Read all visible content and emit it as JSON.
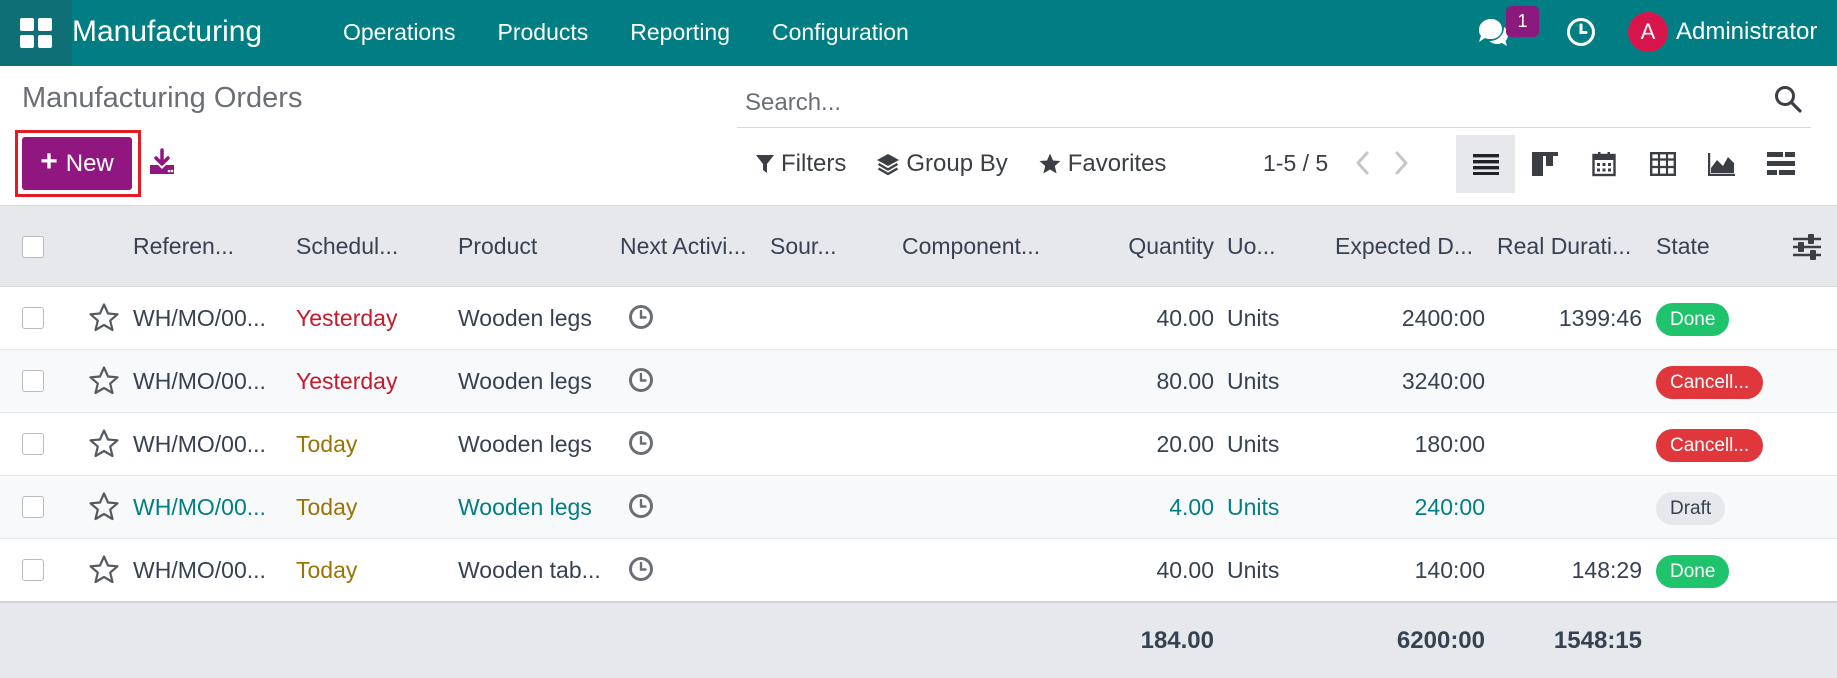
{
  "navbar": {
    "app_title": "Manufacturing",
    "menu": [
      "Operations",
      "Products",
      "Reporting",
      "Configuration"
    ],
    "message_count": "1",
    "avatar_initial": "A",
    "user_name": "Administrator",
    "colors": {
      "bar": "#017e84",
      "badge": "#8c1a7e",
      "avatar": "#d9164b"
    }
  },
  "control_panel": {
    "page_title": "Manufacturing Orders",
    "new_label": "New",
    "search_placeholder": "Search...",
    "filters_label": "Filters",
    "group_by_label": "Group By",
    "favorites_label": "Favorites",
    "pager": "1-5 / 5",
    "views": [
      "list-view-icon",
      "kanban-view-icon",
      "calendar-view-icon",
      "pivot-view-icon",
      "graph-view-icon",
      "gantt-view-icon"
    ]
  },
  "table": {
    "columns": [
      "Referen...",
      "Schedul...",
      "Product",
      "Next Activi...",
      "Sour...",
      "Component...",
      "Quantity",
      "Uo...",
      "Expected D...",
      "Real Durati...",
      "State"
    ],
    "rows": [
      {
        "ref": "WH/MO/00...",
        "scheduled": "Yesterday",
        "product": "Wooden legs",
        "quantity": "40.00",
        "uom": "Units",
        "expected": "2400:00",
        "real": "1399:46",
        "state": "Done"
      },
      {
        "ref": "WH/MO/00...",
        "scheduled": "Yesterday",
        "product": "Wooden legs",
        "quantity": "80.00",
        "uom": "Units",
        "expected": "3240:00",
        "real": "",
        "state": "Cancell..."
      },
      {
        "ref": "WH/MO/00...",
        "scheduled": "Today",
        "product": "Wooden legs",
        "quantity": "20.00",
        "uom": "Units",
        "expected": "180:00",
        "real": "",
        "state": "Cancell..."
      },
      {
        "ref": "WH/MO/00...",
        "scheduled": "Today",
        "product": "Wooden legs",
        "quantity": "4.00",
        "uom": "Units",
        "expected": "240:00",
        "real": "",
        "state": "Draft"
      },
      {
        "ref": "WH/MO/00...",
        "scheduled": "Today",
        "product": "Wooden tab...",
        "quantity": "40.00",
        "uom": "Units",
        "expected": "140:00",
        "real": "148:29",
        "state": "Done"
      }
    ],
    "totals": {
      "quantity": "184.00",
      "expected": "6200:00",
      "real": "1548:15"
    },
    "colors": {
      "done": "#1ec36b",
      "cancelled": "#e0373d",
      "draft": "#e6e8eb",
      "yesterday": "#c41a2c",
      "today": "#997404",
      "highlight": "#017e84"
    }
  }
}
